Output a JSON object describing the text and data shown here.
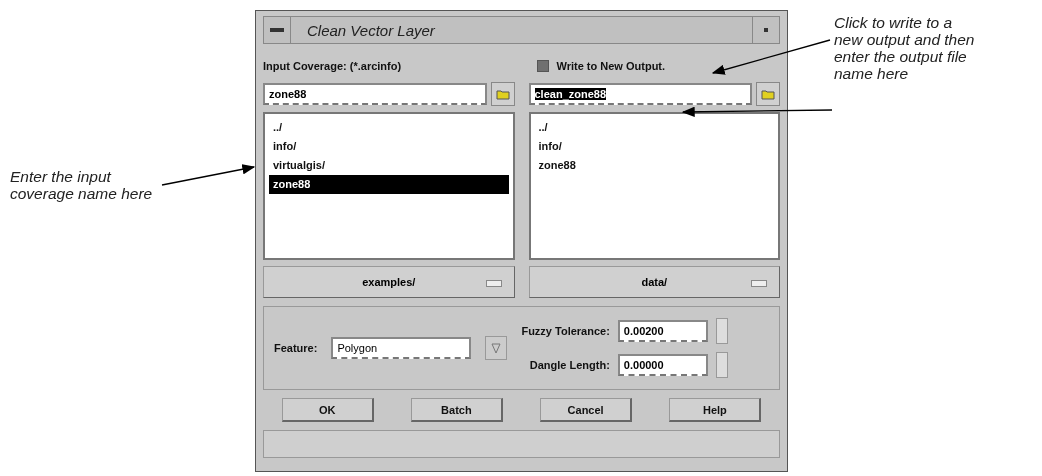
{
  "window": {
    "title": "Clean Vector Layer"
  },
  "input": {
    "label": "Input Coverage: (*.arcinfo)",
    "value": "zone88",
    "directory": "examples/",
    "files": [
      {
        "name": "../",
        "selected": false
      },
      {
        "name": "info/",
        "selected": false
      },
      {
        "name": "virtualgis/",
        "selected": false
      },
      {
        "name": "zone88",
        "selected": true
      }
    ]
  },
  "output": {
    "checkbox": {
      "label": "Write to New Output.",
      "checked": true
    },
    "value": "clean_zone88",
    "value_selected": true,
    "directory": "data/",
    "files": [
      {
        "name": "../",
        "selected": false
      },
      {
        "name": "info/",
        "selected": false
      },
      {
        "name": "zone88",
        "selected": false
      }
    ]
  },
  "feature": {
    "label": "Feature:",
    "value": "Polygon"
  },
  "parameters": [
    {
      "label": "Fuzzy Tolerance:",
      "value": "0.00200"
    },
    {
      "label": "Dangle Length:",
      "value": "0.00000"
    }
  ],
  "buttons": [
    "OK",
    "Batch",
    "Cancel",
    "Help"
  ],
  "left_annotation": [
    "Enter the input",
    "coverage name here"
  ],
  "right_annotation": [
    "Click to write to a",
    "new output and then",
    "enter the output file",
    "name here"
  ]
}
